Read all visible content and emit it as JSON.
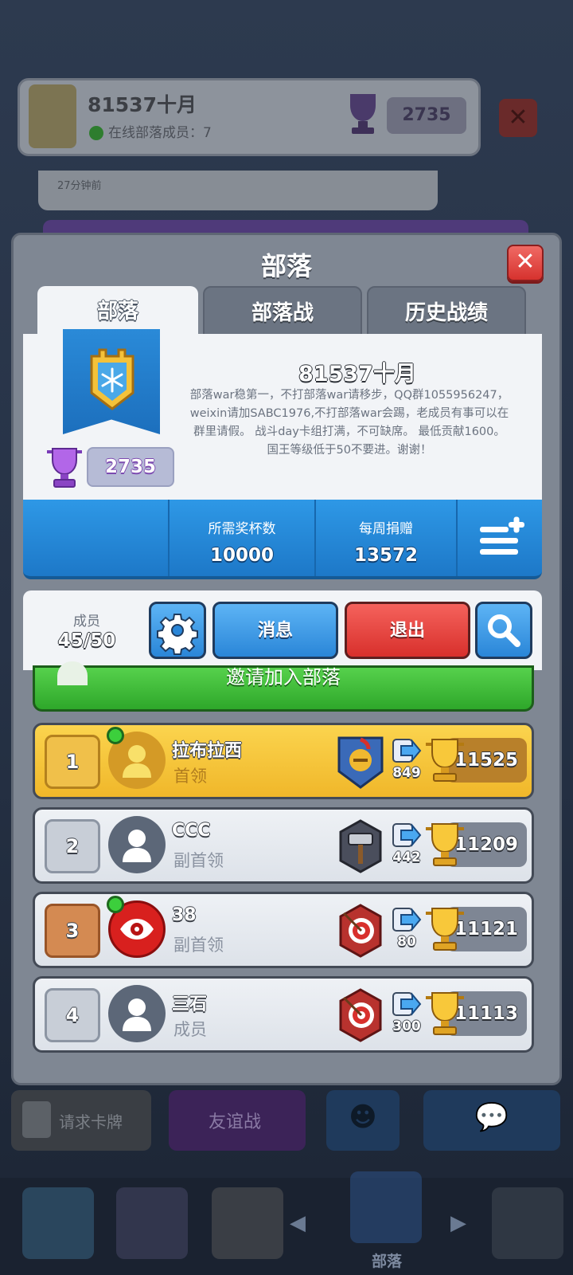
{
  "background": {
    "clan_name": "81537十月",
    "online_text": "在线部落成员：7",
    "trophies": "2735",
    "message_time": "27分钟前",
    "buttons": {
      "request_cards": "请求卡牌",
      "friendly_battle": "友谊战"
    },
    "nav_label": "部落"
  },
  "panel": {
    "title": "部落",
    "tabs": [
      "部落",
      "部落战",
      "历史战绩"
    ],
    "clan": {
      "name": "81537十月",
      "description": "部落war稳第一，不打部落war请移步，QQ群1055956247，weixin请加SABC1976,不打部落war会踢，老成员有事可以在群里请假。 战斗day卡组打满，不可缺席。 最低贡献1600。 国王等级低于50不要进。谢谢！",
      "trophies": "2735"
    },
    "stats": {
      "required_label": "所需奖杯数",
      "required_value": "10000",
      "donations_label": "每周捐赠",
      "donations_value": "13572"
    },
    "members": {
      "label": "成员",
      "count": "45/50"
    },
    "buttons": {
      "message": "消息",
      "leave": "退出",
      "invite": "邀请加入部落"
    },
    "member_list": [
      {
        "rank": "1",
        "name": "拉布拉西",
        "role": "首领",
        "donations": "849",
        "trophies": "11525"
      },
      {
        "rank": "2",
        "name": "CCC",
        "role": "副首领",
        "donations": "442",
        "trophies": "11209"
      },
      {
        "rank": "3",
        "name": "38",
        "role": "副首领",
        "donations": "80",
        "trophies": "11121"
      },
      {
        "rank": "4",
        "name": "三石",
        "role": "成员",
        "donations": "300",
        "trophies": "11113"
      }
    ]
  },
  "colors": {
    "blue_accent": "#2a86d8",
    "red_button": "#d8302c",
    "green_button": "#2ea72a",
    "gold_row": "#f0b72a"
  }
}
